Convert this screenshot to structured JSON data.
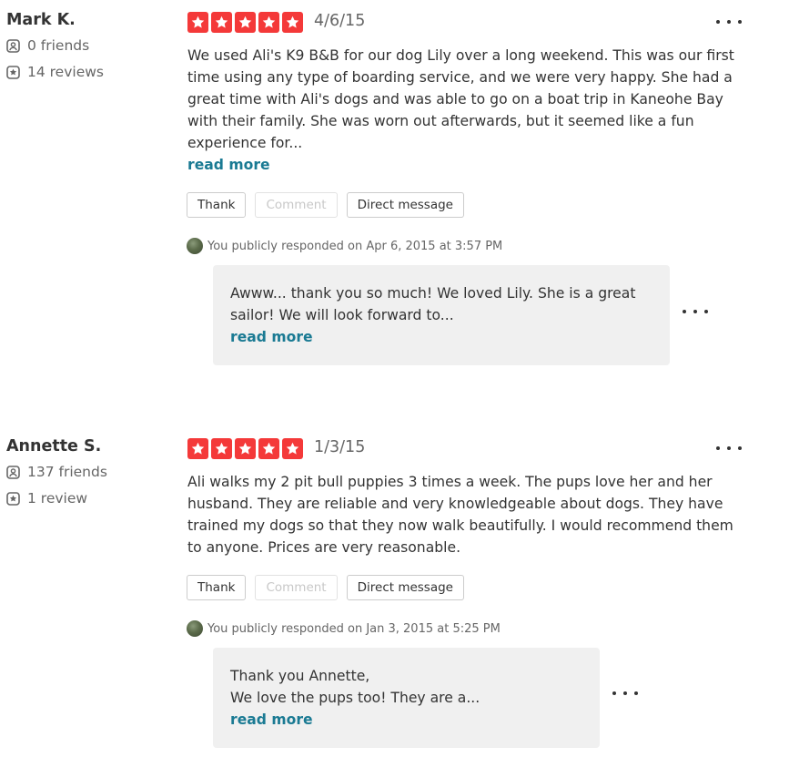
{
  "reviews": [
    {
      "user": {
        "name": "Mark K.",
        "friends": "0 friends",
        "reviews": "14 reviews"
      },
      "rating": 5,
      "date": "4/6/15",
      "text": "We used Ali's K9 B&B for our dog Lily over a long weekend. This was our first time using any type of boarding service, and we were very happy. She had a great time with Ali's dogs and was able to go on a boat trip in Kaneohe Bay with their family. She was worn out afterwards, but it seemed like a fun experience for...",
      "read_more": "read more",
      "actions": {
        "thank": "Thank",
        "comment": "Comment",
        "message": "Direct message"
      },
      "responded": "You publicly responded on Apr 6, 2015 at 3:57 PM",
      "response": {
        "lines": [
          "Awww... thank you so much! We loved Lily. She is a great sailor! We will look forward to..."
        ],
        "read_more": "read more"
      }
    },
    {
      "user": {
        "name": "Annette S.",
        "friends": "137 friends",
        "reviews": "1 review"
      },
      "rating": 5,
      "date": "1/3/15",
      "text": "Ali walks my 2 pit bull puppies 3 times a week. The pups love her and her husband. They are reliable and very knowledgeable about dogs. They have trained my dogs so that they now walk beautifully. I would recommend them to anyone. Prices are very reasonable.",
      "actions": {
        "thank": "Thank",
        "comment": "Comment",
        "message": "Direct message"
      },
      "responded": "You publicly responded on Jan 3, 2015 at 5:25 PM",
      "response": {
        "lines": [
          "Thank you Annette,",
          "We love the pups too! They are a..."
        ],
        "read_more": "read more"
      }
    }
  ],
  "colors": {
    "star_bg": "#f43939",
    "link": "#1a7a93",
    "response_bg": "#f0f0f0"
  },
  "icons": {
    "friends": "friends-icon",
    "reviews": "review-star-icon",
    "star": "star-icon",
    "more": "more-options-icon"
  }
}
